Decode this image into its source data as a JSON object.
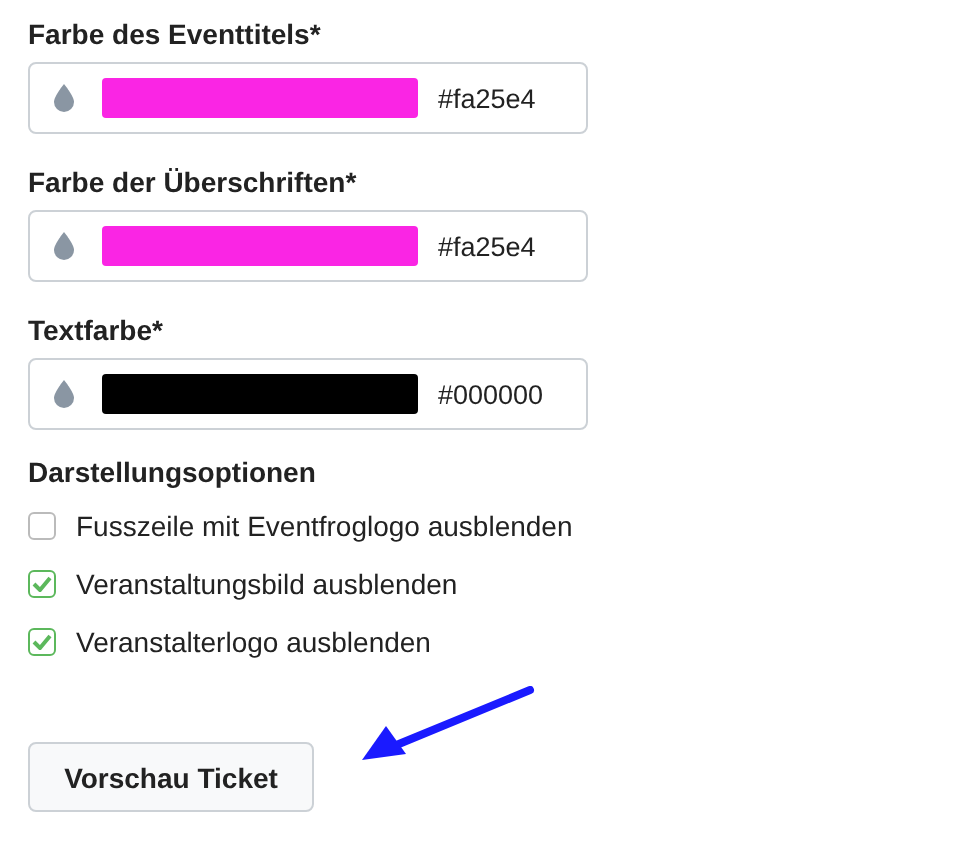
{
  "color_fields": [
    {
      "label": "Farbe des Eventtitels*",
      "color": "#fa25e4",
      "value": "#fa25e4"
    },
    {
      "label": "Farbe der Überschriften*",
      "color": "#fa25e4",
      "value": "#fa25e4"
    },
    {
      "label": "Textfarbe*",
      "color": "#000000",
      "value": "#000000"
    }
  ],
  "display_options": {
    "heading": "Darstellungsoptionen",
    "options": [
      {
        "label": "Fusszeile mit Eventfroglogo ausblenden",
        "checked": false
      },
      {
        "label": "Veranstaltungsbild ausblenden",
        "checked": true
      },
      {
        "label": "Veranstalterlogo ausblenden",
        "checked": true
      }
    ]
  },
  "preview_button": "Vorschau Ticket"
}
